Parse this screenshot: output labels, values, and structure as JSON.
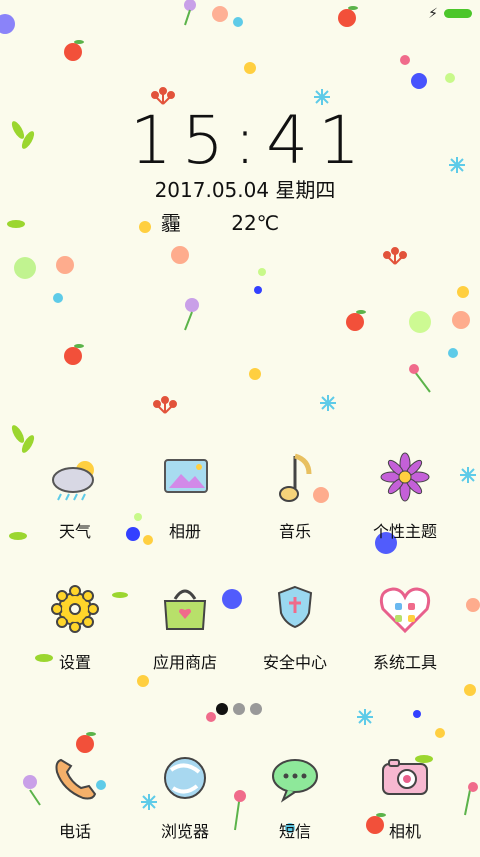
{
  "status": {
    "battery_color": "#4cc62a"
  },
  "clock": {
    "time": "15:41",
    "date": "2017.05.04  星期四"
  },
  "weather": {
    "condition": "霾",
    "temperature": "22℃"
  },
  "apps": [
    {
      "label": "天气",
      "icon": "weather-icon"
    },
    {
      "label": "相册",
      "icon": "gallery-icon"
    },
    {
      "label": "音乐",
      "icon": "music-icon"
    },
    {
      "label": "个性主题",
      "icon": "theme-icon"
    },
    {
      "label": "设置",
      "icon": "settings-icon"
    },
    {
      "label": "应用商店",
      "icon": "app-store-icon"
    },
    {
      "label": "安全中心",
      "icon": "security-icon"
    },
    {
      "label": "系统工具",
      "icon": "system-tools-icon"
    }
  ],
  "dock": [
    {
      "label": "电话",
      "icon": "phone-icon"
    },
    {
      "label": "浏览器",
      "icon": "browser-icon"
    },
    {
      "label": "短信",
      "icon": "messages-icon"
    },
    {
      "label": "相机",
      "icon": "camera-icon"
    }
  ],
  "pager": {
    "total": 3,
    "active": 1
  }
}
